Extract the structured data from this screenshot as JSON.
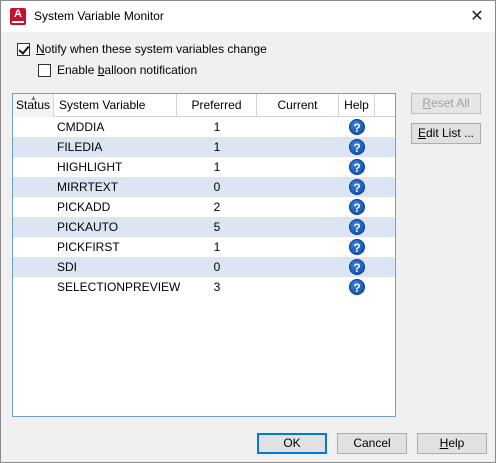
{
  "window": {
    "title": "System Variable Monitor",
    "icon_letter": "A"
  },
  "options": {
    "notify_label": "Notify when these system variables change",
    "notify_checked": true,
    "balloon_label": "Enable balloon notification",
    "balloon_checked": false
  },
  "grid": {
    "columns": [
      "Status",
      "System Variable",
      "Preferred",
      "Current",
      "Help"
    ],
    "sorted_column": "Status",
    "rows": [
      {
        "name": "CMDDIA",
        "preferred": "1",
        "current": ""
      },
      {
        "name": "FILEDIA",
        "preferred": "1",
        "current": ""
      },
      {
        "name": "HIGHLIGHT",
        "preferred": "1",
        "current": ""
      },
      {
        "name": "MIRRTEXT",
        "preferred": "0",
        "current": ""
      },
      {
        "name": "PICKADD",
        "preferred": "2",
        "current": ""
      },
      {
        "name": "PICKAUTO",
        "preferred": "5",
        "current": ""
      },
      {
        "name": "PICKFIRST",
        "preferred": "1",
        "current": ""
      },
      {
        "name": "SDI",
        "preferred": "0",
        "current": ""
      },
      {
        "name": "SELECTIONPREVIEW",
        "preferred": "3",
        "current": ""
      }
    ],
    "help_icon_glyph": "?",
    "alt_row_color": "#dbe5f4"
  },
  "side_buttons": {
    "reset_all": "Reset All",
    "edit_list": "Edit List ..."
  },
  "footer": {
    "ok": "OK",
    "cancel": "Cancel",
    "help": "Help"
  },
  "colors": {
    "accent": "#0078d7",
    "app_icon": "#c8102e"
  }
}
